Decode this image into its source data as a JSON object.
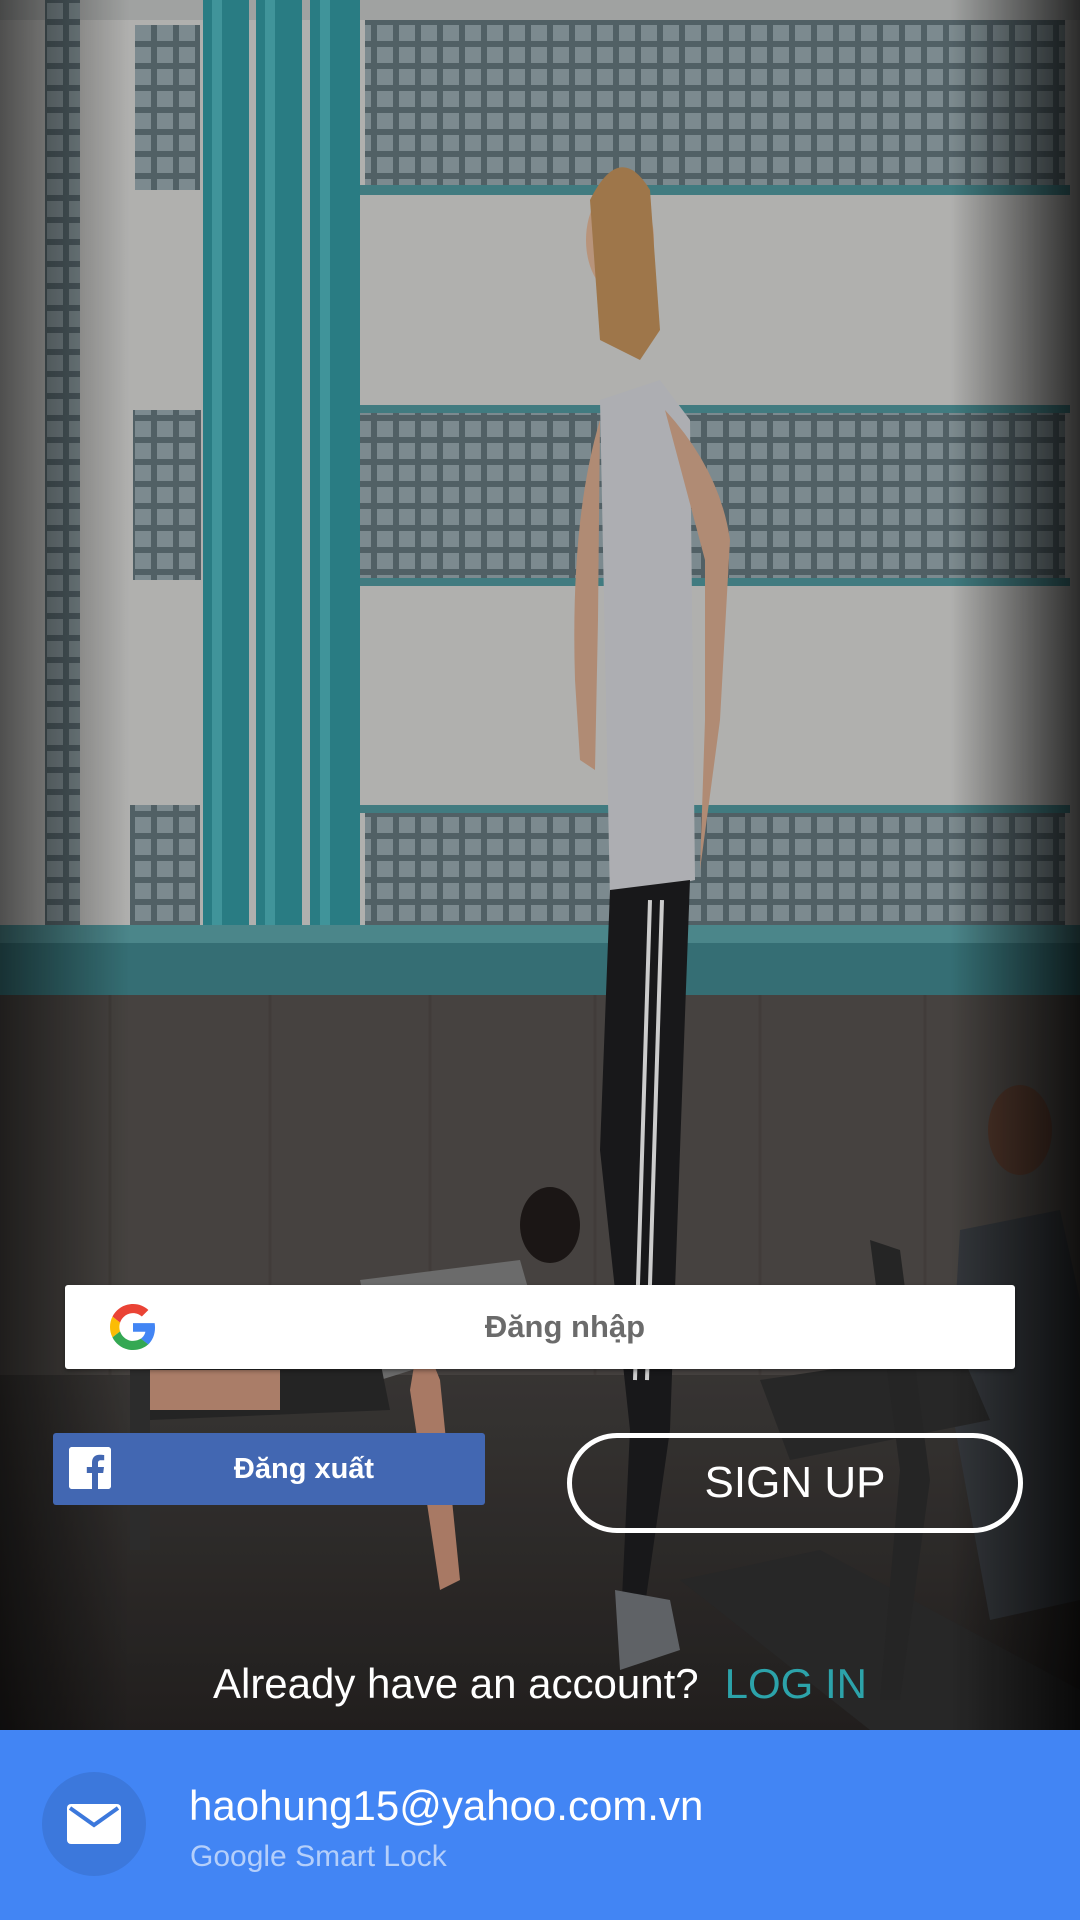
{
  "google_signin": {
    "label": "Đăng nhập",
    "icon": "google-g-icon"
  },
  "facebook_button": {
    "label": "Đăng xuất",
    "icon": "facebook-f-icon",
    "color": "#4267b2"
  },
  "signup_button": {
    "label": "SIGN UP"
  },
  "login_prompt": {
    "question": "Already have an account?",
    "link": "LOG IN",
    "link_color": "#2ca3aa"
  },
  "smart_lock": {
    "email": "haohung15@yahoo.com.vn",
    "subtitle": "Google Smart Lock",
    "icon": "mail-icon",
    "color": "#4285f4"
  }
}
